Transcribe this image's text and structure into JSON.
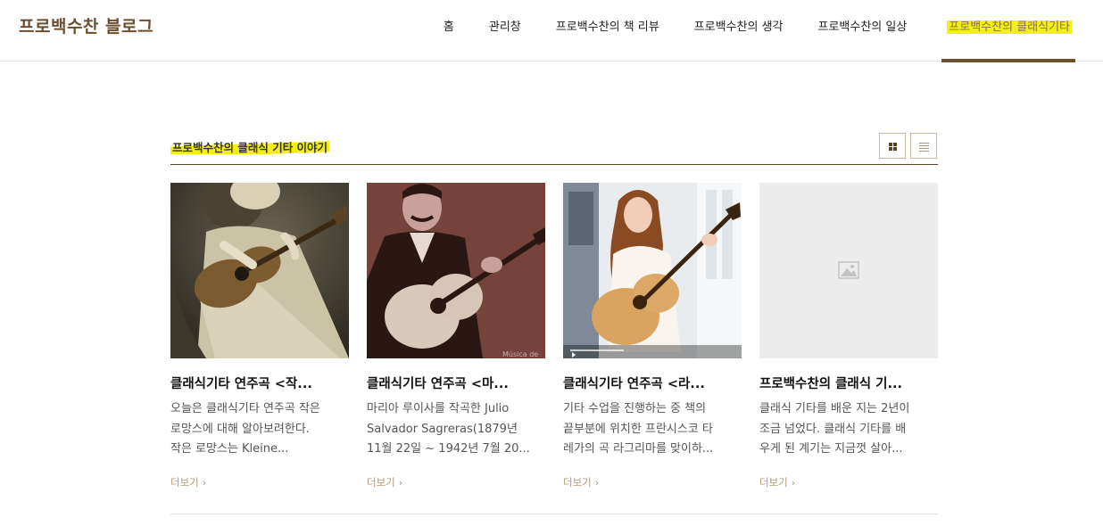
{
  "header": {
    "logo": "프로백수찬 블로그",
    "nav": [
      {
        "label": "홈"
      },
      {
        "label": "관리창"
      },
      {
        "label": "프로백수찬의 책 리뷰"
      },
      {
        "label": "프로백수찬의 생각"
      },
      {
        "label": "프로백수찬의 일상"
      },
      {
        "label": "프로백수찬의 클래식기타",
        "active": true
      }
    ],
    "accent_color": "#6e5230",
    "highlight_color": "#f2f016"
  },
  "section": {
    "title": "프로백수찬의 클래식 기타 이야기",
    "view_modes": [
      "grid-view-icon",
      "list-view-icon"
    ],
    "selected_view": "grid"
  },
  "posts": [
    {
      "title": "클래식기타 연주곡 <작...",
      "desc": [
        "오늘은 클래식기타 연주곡 작은",
        "로망스에 대해 알아보려한다.",
        "작은 로망스는 Kleine..."
      ],
      "more": "더보기",
      "thumbnail": "woman-playing-guitar-sepia-photo",
      "watermark": ""
    },
    {
      "title": "클래식기타 연주곡 <마...",
      "desc": [
        "마리아 루이사를 작곡한 Julio",
        "Salvador Sagreras(1879년",
        "11월 22일 ~ 1942년 7월 20..."
      ],
      "more": "더보기",
      "thumbnail": "man-with-mustache-playing-guitar-photo",
      "watermark": "Música de"
    },
    {
      "title": "클래식기타 연주곡 <라...",
      "desc": [
        "기타 수업을 진행하는 중 책의",
        "끝부분에 위치한 프란시스코 타",
        "레가의 곡 라그리마를 맞이하..."
      ],
      "more": "더보기",
      "thumbnail": "woman-playing-classical-guitar-video-still",
      "watermark": ""
    },
    {
      "title": "프로백수찬의 클래식 기...",
      "desc": [
        "클래식 기타를 배운 지는 2년이",
        "조금 넘었다. 클래식 기타를 배",
        "우게 된 계기는 지금껏 살아..."
      ],
      "more": "더보기",
      "thumbnail": "image-placeholder-icon",
      "watermark": ""
    }
  ]
}
